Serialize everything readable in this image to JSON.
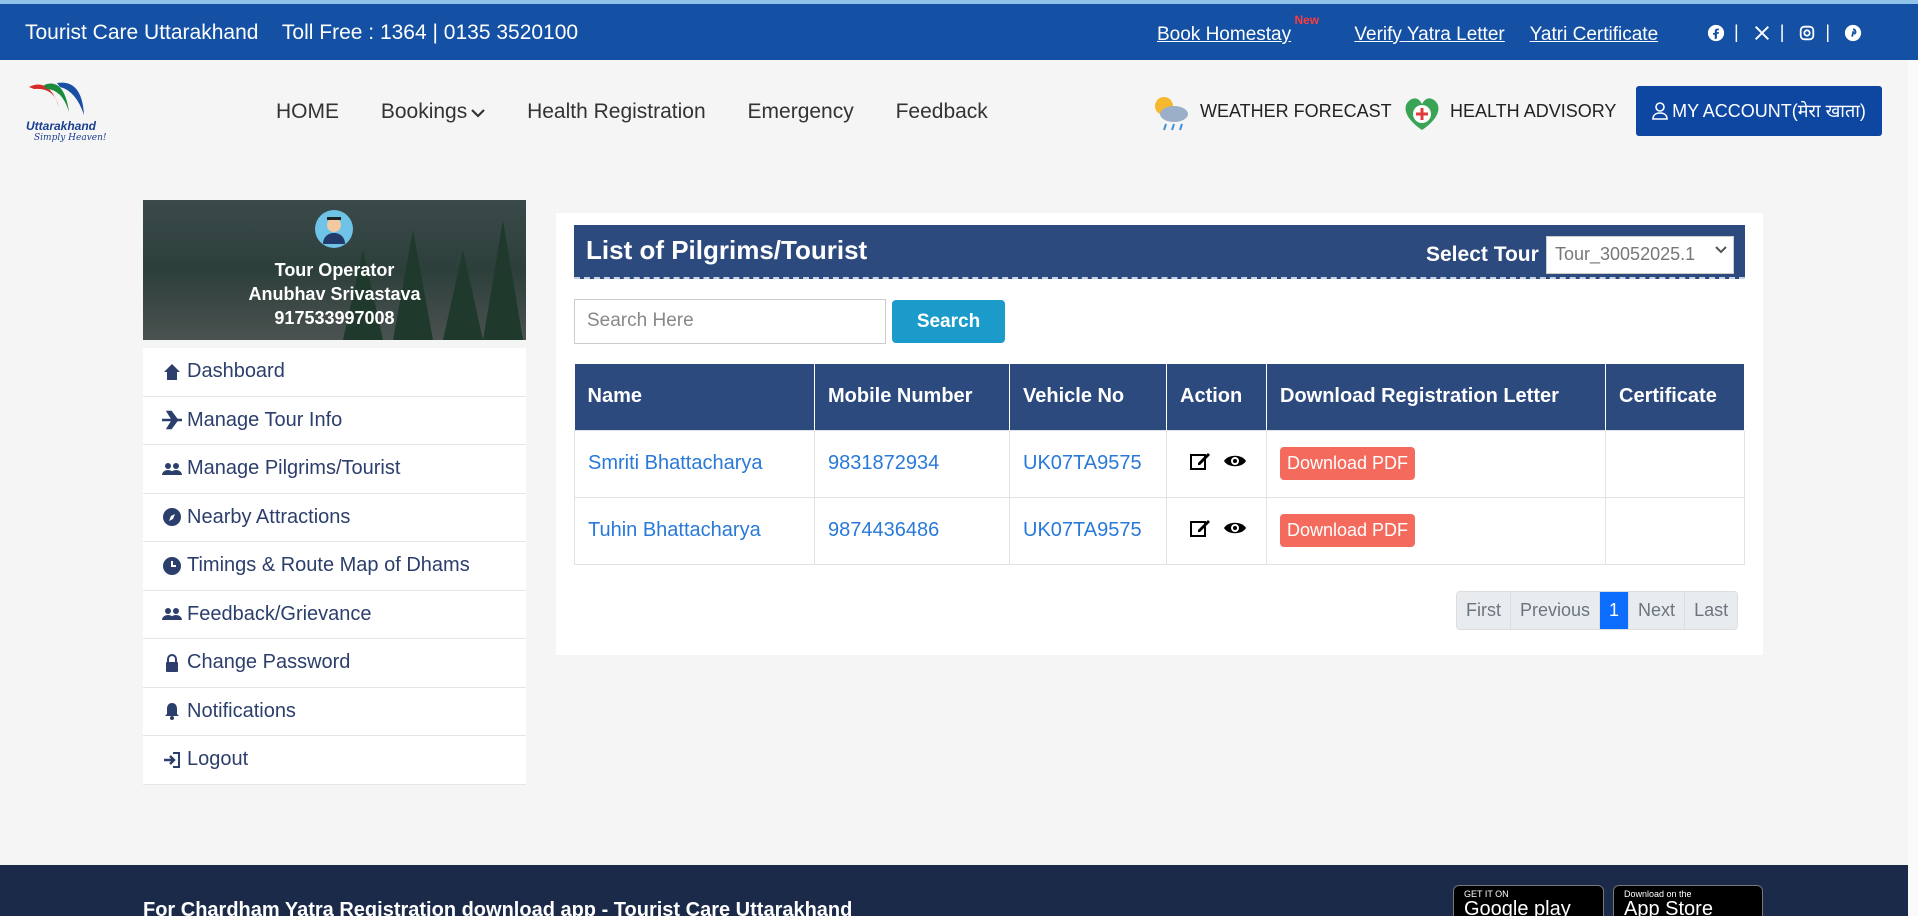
{
  "topbar": {
    "brand": "Tourist Care Uttarakhand",
    "tollfree": "Toll Free : 1364 | 0135 3520100",
    "links": [
      "Book Homestay",
      "Verify Yatra Letter",
      "Yatri Certificate"
    ],
    "new_badge": "New",
    "social_icons": [
      "facebook-icon",
      "x-icon",
      "instagram-icon",
      "pinterest-icon"
    ]
  },
  "header": {
    "logo_text": "Uttarakhand",
    "logo_tagline": "Simply Heaven!",
    "nav": [
      "HOME",
      "Bookings",
      "Health Registration",
      "Emergency",
      "Feedback"
    ],
    "weather": "WEATHER FORECAST",
    "health": "HEALTH ADVISORY",
    "account": "MY ACCOUNT(मेरा खाता)"
  },
  "profile": {
    "role": "Tour Operator",
    "name": "Anubhav Srivastava",
    "phone": "917533997008"
  },
  "sidebar": {
    "items": [
      {
        "label": "Dashboard",
        "icon": "home-icon"
      },
      {
        "label": "Manage Tour Info",
        "icon": "plane-icon"
      },
      {
        "label": "Manage Pilgrims/Tourist",
        "icon": "users-icon"
      },
      {
        "label": "Nearby Attractions",
        "icon": "compass-icon"
      },
      {
        "label": "Timings & Route Map of Dhams",
        "icon": "clock-icon"
      },
      {
        "label": "Feedback/Grievance",
        "icon": "users-icon"
      },
      {
        "label": "Change Password",
        "icon": "lock-icon"
      },
      {
        "label": "Notifications",
        "icon": "bell-icon"
      },
      {
        "label": "Logout",
        "icon": "logout-icon"
      }
    ]
  },
  "main": {
    "title": "List of Pilgrims/Tourist",
    "select_label": "Select Tour",
    "select_value": "Tour_30052025.1",
    "search_placeholder": "Search Here",
    "search_button": "Search",
    "columns": [
      "Name",
      "Mobile Number",
      "Vehicle No",
      "Action",
      "Download Registration Letter",
      "Certificate"
    ],
    "rows": [
      {
        "name": "Smriti Bhattacharya",
        "mobile": "9831872934",
        "vehicle": "UK07TA9575",
        "download": "Download PDF",
        "certificate": ""
      },
      {
        "name": "Tuhin Bhattacharya",
        "mobile": "9874436486",
        "vehicle": "UK07TA9575",
        "download": "Download PDF",
        "certificate": ""
      }
    ],
    "pager": [
      "First",
      "Previous",
      "1",
      "Next",
      "Last"
    ]
  },
  "footer": {
    "text": "For Chardham Yatra Registration download app - Tourist Care Uttarakhand",
    "google_top": "GET IT ON",
    "google_bottom": "Google play",
    "apple_top": "Download on the",
    "apple_bottom": "App Store"
  }
}
